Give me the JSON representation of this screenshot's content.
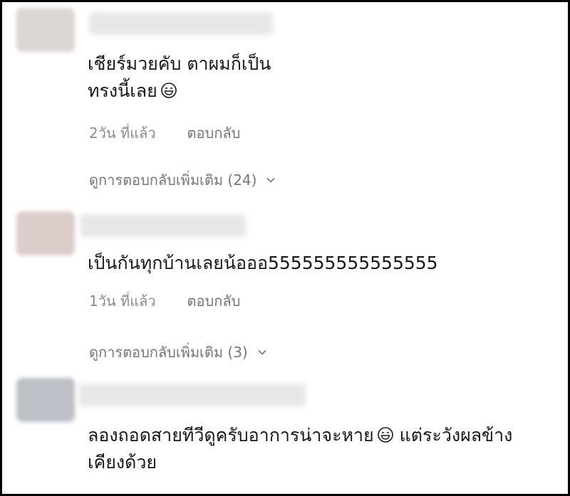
{
  "comments": [
    {
      "text_lines": [
        "เชียร์มวยคับ ตาผมก็เป็น",
        "ทรงนี้เลย"
      ],
      "emoji": "grinning-face-emoji",
      "time": "2วัน ที่แล้ว",
      "reply_label": "ตอบกลับ",
      "more_replies": "ดูการตอบกลับเพิ่มเติม (24)",
      "avatar_color": "#d9d4d3"
    },
    {
      "text_lines": [
        "เป็นกันทุกบ้านเลยน้อออ555555555555555"
      ],
      "time": "1วัน ที่แล้ว",
      "reply_label": "ตอบกลับ",
      "more_replies": "ดูการตอบกลับเพิ่มเติม (3)",
      "avatar_color": "#d8c9c8"
    },
    {
      "text_lines": [
        "ลองถอดสายทีวีดูครับอาการน่าจะหาย",
        " แต่ระวังผลข้าง",
        "เคียงด้วย"
      ],
      "emoji": "grinning-face-emoji",
      "avatar_color": "#b9bcc2"
    }
  ],
  "colors": {
    "text": "#161823",
    "meta": "#8a8b91",
    "link": "#75767c",
    "frame": "#000000"
  }
}
